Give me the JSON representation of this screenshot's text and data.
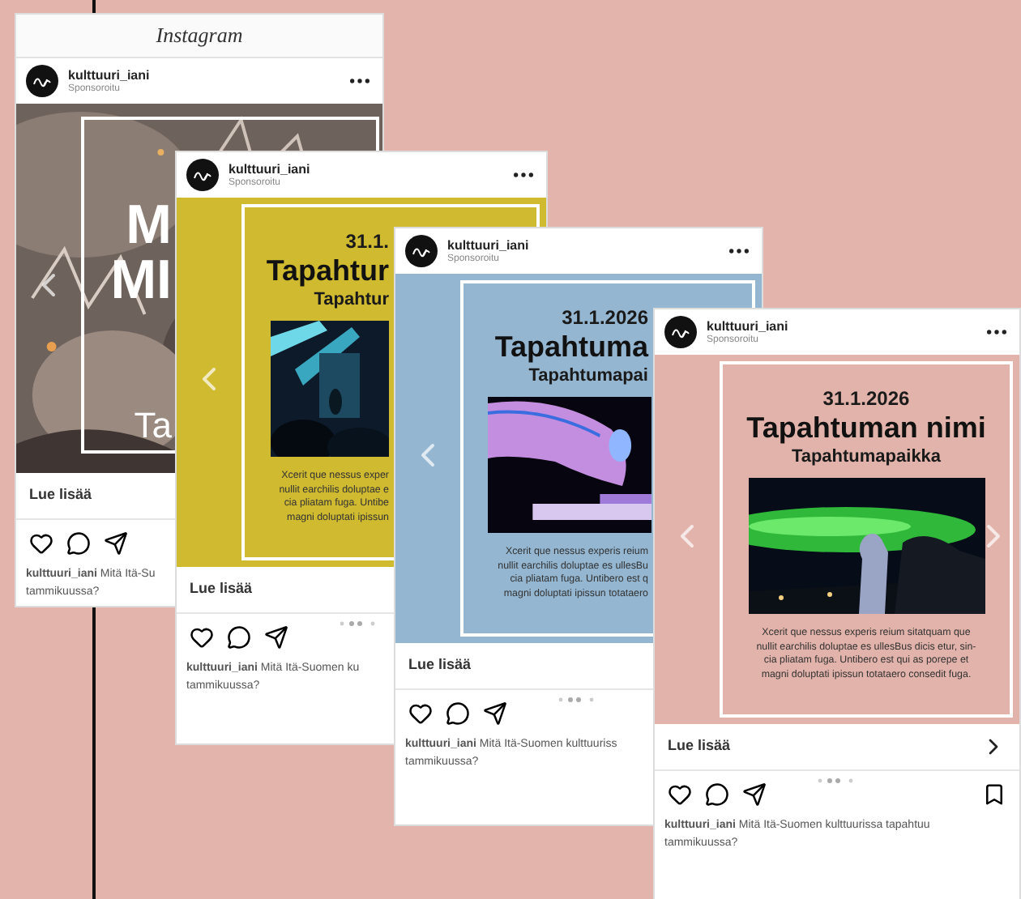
{
  "posts": [
    {
      "app_title": "Instagram",
      "account": "kulttuuri_iani",
      "sponsored": "Sponsoroitu",
      "slide": {
        "kind": "photo_title",
        "lines": [
          "M",
          "MI",
          "Ta"
        ],
        "prev_arrow": true
      },
      "cta": "Lue lisää",
      "caption": [
        "**kulttuuri_iani** Mitä Itä-Su",
        "tammikuussa?"
      ]
    },
    {
      "account": "kulttuuri_iani",
      "sponsored": "Sponsoroitu",
      "slide": {
        "kind": "event",
        "color": "#d0ba30",
        "date": "31.1.",
        "title": "Tapahtur",
        "place": "Tapahtur",
        "body": [
          "Xcerit que nessus exper",
          "nullit earchilis doluptae e",
          "cia pliatam fuga. Untibe",
          "magni doluptati ipissun"
        ],
        "prev_arrow": true
      },
      "cta": "Lue lisää",
      "caption": [
        "**kulttuuri_iani** Mitä Itä-Suomen ku",
        "tammikuussa?"
      ]
    },
    {
      "account": "kulttuuri_iani",
      "sponsored": "Sponsoroitu",
      "slide": {
        "kind": "event",
        "color": "#94b6d0",
        "date": "31.1.2026",
        "title": "Tapahtuma",
        "place": "Tapahtumapai",
        "body": [
          "Xcerit que nessus experis reium",
          "nullit earchilis doluptae es ullesBu",
          "cia pliatam fuga. Untibero est q",
          "magni doluptati ipissun totataero"
        ],
        "prev_arrow": true
      },
      "cta": "Lue lisää",
      "caption": [
        "**kulttuuri_iani** Mitä Itä-Suomen kulttuuriss",
        "tammikuussa?"
      ]
    },
    {
      "account": "kulttuuri_iani",
      "sponsored": "Sponsoroitu",
      "slide": {
        "kind": "event",
        "color": "#e2b3aa",
        "date": "31.1.2026",
        "title": "Tapahtuman nimi",
        "place": "Tapahtumapaikka",
        "body": [
          "Xcerit que nessus experis reium sitatquam que",
          "nullit earchilis doluptae es ullesBus dicis etur, sin-",
          "cia pliatam fuga. Untibero est qui as porepe et",
          "magni doluptati ipissun totataero consedit fuga."
        ],
        "prev_arrow": true,
        "next_arrow": true
      },
      "cta": "Lue lisää",
      "cta_arrow": true,
      "bookmark": true,
      "caption": [
        "**kulttuuri_iani** Mitä Itä-Suomen kulttuurissa tapahtuu",
        "tammikuussa?"
      ]
    }
  ]
}
